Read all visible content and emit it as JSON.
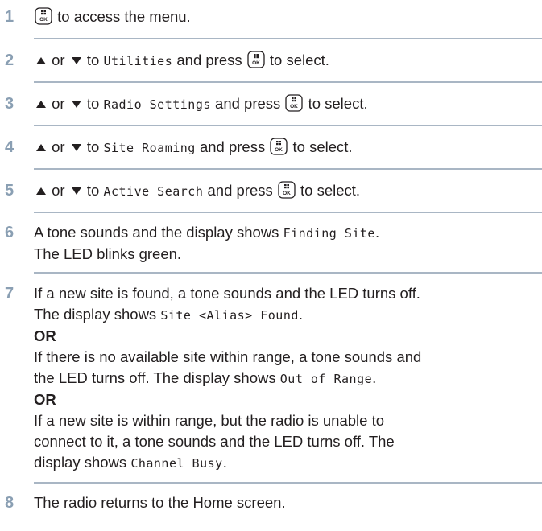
{
  "steps": [
    {
      "number": "1",
      "parts": {
        "a": "to access the menu."
      }
    },
    {
      "number": "2",
      "parts": {
        "or": "or",
        "to": "to",
        "item": "Utilities",
        "press": "and press",
        "select": "to select."
      }
    },
    {
      "number": "3",
      "parts": {
        "or": "or",
        "to": "to",
        "item": "Radio Settings",
        "press": "and press",
        "select": "to select."
      }
    },
    {
      "number": "4",
      "parts": {
        "or": "or",
        "to": "to",
        "item": "Site Roaming",
        "press": "and press",
        "select": "to select."
      }
    },
    {
      "number": "5",
      "parts": {
        "or": "or",
        "to": "to",
        "item": "Active Search",
        "press": "and press",
        "select": "to select."
      }
    },
    {
      "number": "6",
      "parts": {
        "l1a": "A tone sounds and the display shows",
        "l1b": "Finding Site",
        "l1c": ".",
        "l2": "The LED blinks green."
      }
    },
    {
      "number": "7",
      "parts": {
        "l1": "If a new site is found, a tone sounds and the LED turns off.",
        "l2a": "The display shows",
        "l2b": "Site <Alias> Found",
        "l2c": ".",
        "or1": "OR",
        "l3": "If there is no available site within range, a tone sounds and",
        "l4a": "the LED turns off. The display shows",
        "l4b": "Out of Range",
        "l4c": ".",
        "or2": "OR",
        "l5": "If a new site is within range, but the radio is unable to",
        "l6": "connect to it, a tone sounds and the LED turns off. The",
        "l7a": "display shows",
        "l7b": "Channel Busy",
        "l7c": "."
      }
    },
    {
      "number": "8",
      "parts": {
        "a": "The radio returns to the Home screen."
      }
    }
  ],
  "icons": {
    "menu_ok_key": "menu-ok-key-icon",
    "up_arrow": "up-arrow-icon",
    "down_arrow": "down-arrow-icon"
  },
  "colors": {
    "step_number": "#8a9fb3",
    "rule": "#a9b6c4",
    "text": "#231f20"
  }
}
